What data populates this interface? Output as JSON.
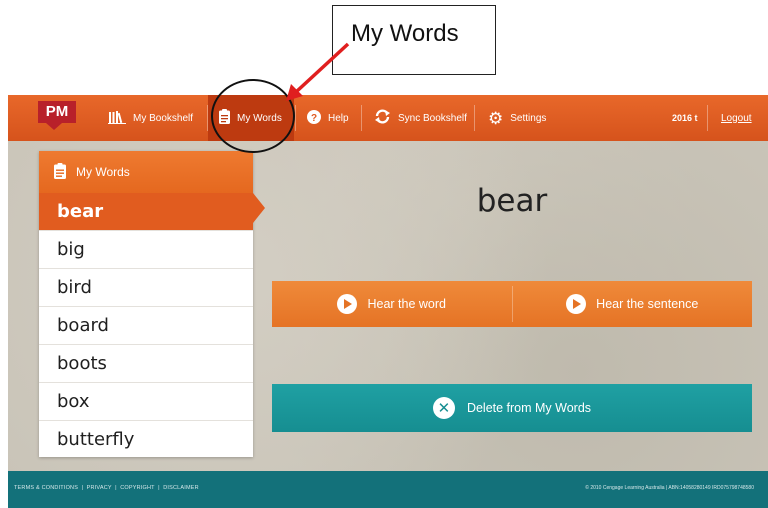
{
  "callout": {
    "label": "My Words"
  },
  "nav": {
    "logo": "PM",
    "bookshelf": "My Bookshelf",
    "my_words": "My Words",
    "help": "Help",
    "sync": "Sync Bookshelf",
    "settings": "Settings",
    "user": "2016 t",
    "logout": "Logout"
  },
  "panel": {
    "title": "My Words",
    "words": [
      "bear",
      "big",
      "bird",
      "board",
      "boots",
      "box",
      "butterfly"
    ],
    "selected": "bear"
  },
  "main": {
    "current_word": "bear",
    "hear_word": "Hear the word",
    "hear_sentence": "Hear the sentence",
    "delete": "Delete from My Words"
  },
  "footer": {
    "terms": "TERMS & CONDITIONS",
    "privacy": "PRIVACY",
    "copyright": "COPYRIGHT",
    "disclaimer": "DISCLAIMER",
    "copy_text": "© 2010 Cengage Learning Australia | ABN:14058280149 IRD075798748580"
  },
  "colors": {
    "nav_orange": "#e05a21",
    "nav_active": "#bd3a10",
    "logo_red": "#b8202a",
    "selected_word": "#e15c1f",
    "teal": "#168e91",
    "footer_teal": "#13717a",
    "arrow_red": "#e01f1f"
  }
}
